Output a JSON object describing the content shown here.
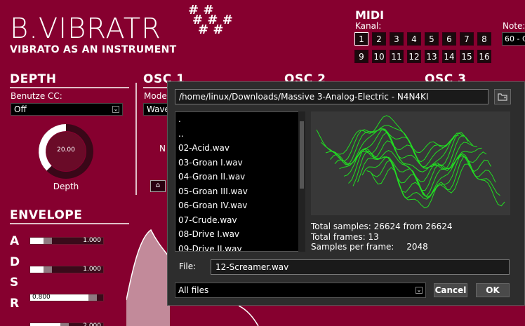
{
  "header": {
    "logo": "B.VIBRATR",
    "subtitle": "VIBRATO AS AN INSTRUMENT",
    "hashes": [
      "# #",
      "# # #",
      "# #"
    ]
  },
  "midi": {
    "title": "MIDI",
    "kanal_label": "Kanal:",
    "channels_row1": [
      "1",
      "2",
      "3",
      "4",
      "5",
      "6",
      "7",
      "8"
    ],
    "channels_row2": [
      "9",
      "10",
      "11",
      "12",
      "13",
      "14",
      "15",
      "16"
    ],
    "active_channel": "1",
    "note_label": "Note:",
    "note_value": "60 - C"
  },
  "depth": {
    "title": "DEPTH",
    "cc_label": "Benutze CC:",
    "cc_value": "Off",
    "knob_value": "20.00",
    "knob_label": "Depth"
  },
  "osc1": {
    "title": "OSC 1",
    "mode_label": "Mode",
    "mode_value": "Wave",
    "n_label": "N"
  },
  "osc2": {
    "title": "OSC 2"
  },
  "osc3": {
    "title": "OSC 3"
  },
  "envelope": {
    "title": "ENVELOPE",
    "rows": [
      {
        "letter": "A",
        "value": "1.000",
        "fill": 0.18
      },
      {
        "letter": "D",
        "value": "1.000",
        "fill": 0.18
      },
      {
        "letter": "S",
        "value": "0.800",
        "fill": 0.8
      },
      {
        "letter": "R",
        "value": "2.000",
        "fill": 0.41
      }
    ]
  },
  "dialog": {
    "path": "/home/linux/Downloads/Massive 3-Analog-Electric - N4N4KI",
    "files": [
      ".",
      "..",
      "02-Acid.wav",
      "03-Groan I.wav",
      "04-Groan II.wav",
      "05-Groan III.wav",
      "06-Groan IV.wav",
      "07-Crude.wav",
      "08-Drive I.wav",
      "09-Drive II.wav"
    ],
    "total_samples": "Total samples: 26624 from 26624",
    "total_frames": "Total frames: 13",
    "samples_per_frame_label": "Samples per frame:",
    "samples_per_frame_value": "2048",
    "file_label": "File:",
    "file_value": "12-Screamer.wav",
    "filter": "All files",
    "cancel": "Cancel",
    "ok": "OK",
    "wave_color": "#22dd22"
  },
  "colors": {
    "background": "#86002f",
    "dialog": "#2d2d2d"
  }
}
